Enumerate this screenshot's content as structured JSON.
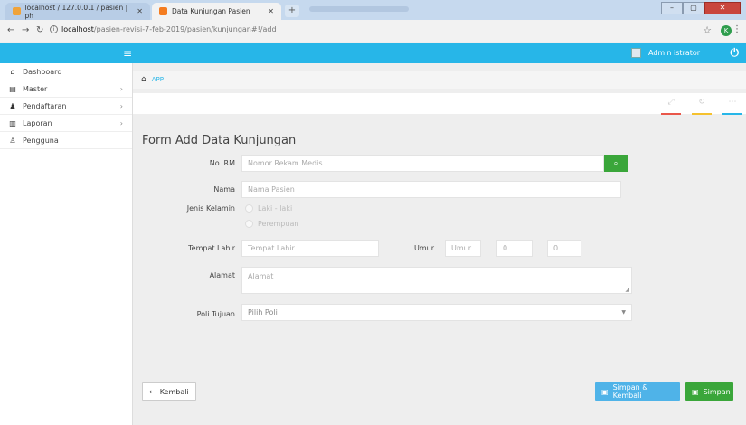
{
  "browser": {
    "tabs": [
      {
        "title": "localhost / 127.0.0.1 / pasien | ph",
        "icon": "phpmyadmin-icon"
      },
      {
        "title": "Data Kunjungan Pasien",
        "icon": "app-favicon-icon"
      }
    ],
    "url_host": "localhost",
    "url_path": "/pasien-revisi-7-feb-2019/pasien/kunjungan#!/add",
    "profile_initial": "K"
  },
  "header": {
    "user": "Admin istrator",
    "accent": "#27b6e8"
  },
  "sidebar": {
    "items": [
      {
        "label": "Dashboard",
        "icon": "home-icon",
        "has_children": false
      },
      {
        "label": "Master",
        "icon": "database-icon",
        "has_children": true
      },
      {
        "label": "Pendaftaran",
        "icon": "users-icon",
        "has_children": true
      },
      {
        "label": "Laporan",
        "icon": "bar-chart-icon",
        "has_children": true
      },
      {
        "label": "Pengguna",
        "icon": "user-icon",
        "has_children": false
      }
    ]
  },
  "breadcrumb": {
    "label": "APP"
  },
  "form": {
    "title": "Form Add Data Kunjungan",
    "no_rm": {
      "label": "No. RM",
      "placeholder": "Nomor Rekam Medis"
    },
    "nama": {
      "label": "Nama",
      "placeholder": "Nama Pasien"
    },
    "jenis_kelamin": {
      "label": "Jenis Kelamin",
      "options": [
        "Laki - laki",
        "Perempuan"
      ]
    },
    "tempat_lahir": {
      "label": "Tempat Lahir",
      "placeholder": "Tempat Lahir"
    },
    "umur": {
      "label": "Umur",
      "placeholder": "Umur",
      "months": "0",
      "days": "0"
    },
    "alamat": {
      "label": "Alamat",
      "placeholder": "Alamat"
    },
    "poli": {
      "label": "Poli Tujuan",
      "selected": "Pilih Poli"
    }
  },
  "buttons": {
    "back": "Kembali",
    "save_return": "Simpan & Kembali",
    "save": "Simpan"
  }
}
